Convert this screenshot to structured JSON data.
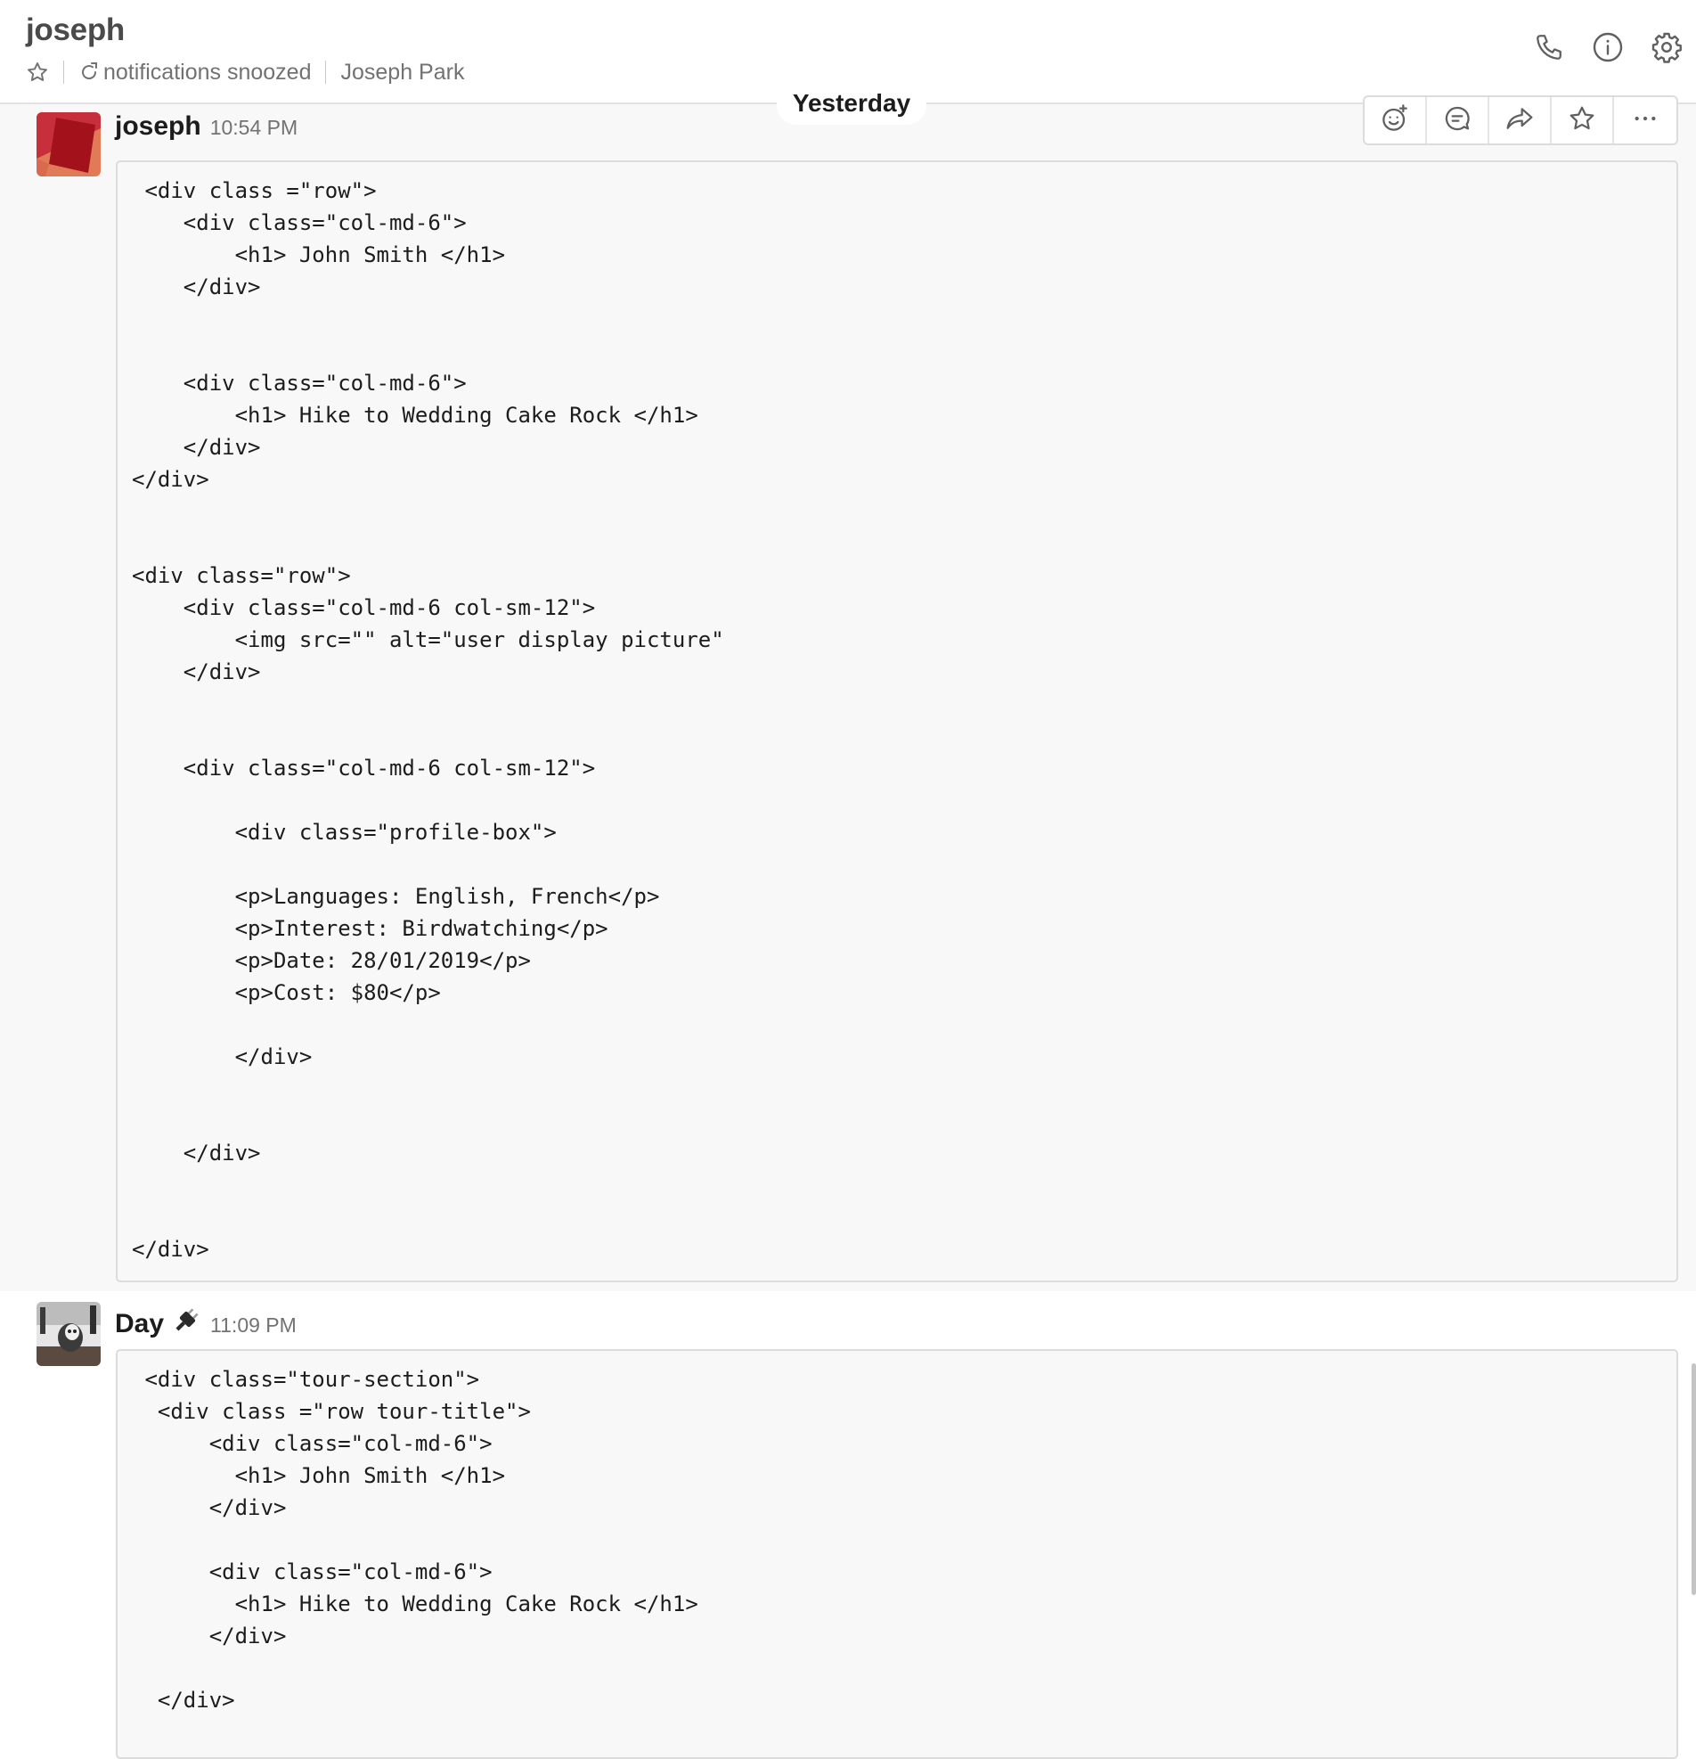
{
  "header": {
    "channel_name": "joseph",
    "notifications_status": "notifications snoozed",
    "member_name": "Joseph Park",
    "actions": [
      "phone-icon",
      "info-icon",
      "gear-icon"
    ]
  },
  "date_divider": "Yesterday",
  "messages": [
    {
      "sender": "joseph",
      "time": "10:54 PM",
      "code": " <div class =\"row\">\n    <div class=\"col-md-6\">\n        <h1> John Smith </h1>\n    </div>\n\n\n    <div class=\"col-md-6\">\n        <h1> Hike to Wedding Cake Rock </h1>\n    </div>\n</div>\n\n\n<div class=\"row\">\n    <div class=\"col-md-6 col-sm-12\">\n        <img src=\"\" alt=\"user display picture\"\n    </div>\n\n\n    <div class=\"col-md-6 col-sm-12\">\n\n        <div class=\"profile-box\">\n\n        <p>Languages: English, French</p>\n        <p>Interest: Birdwatching</p>\n        <p>Date: 28/01/2019</p>\n        <p>Cost: $80</p>\n\n        </div>\n\n\n    </div>\n\n\n</div>",
      "hover_actions": [
        "add-reaction-icon",
        "start-thread-icon",
        "share-message-icon",
        "star-icon",
        "more-actions-icon"
      ]
    },
    {
      "sender": "Day",
      "status_icon": "plug-icon",
      "time": "11:09 PM",
      "code": " <div class=\"tour-section\">\n  <div class =\"row tour-title\">\n      <div class=\"col-md-6\">\n        <h1> John Smith </h1>\n      </div>\n\n      <div class=\"col-md-6\">\n        <h1> Hike to Wedding Cake Rock </h1>\n      </div>\n\n  </div>"
    }
  ],
  "colors": {
    "text": "#1d1c1d",
    "muted": "#717274",
    "hover_bg": "#f8f8f8",
    "code_bg": "#f8f8f8",
    "code_border": "#dcdcdc",
    "avatar_red": "#b3141e"
  }
}
